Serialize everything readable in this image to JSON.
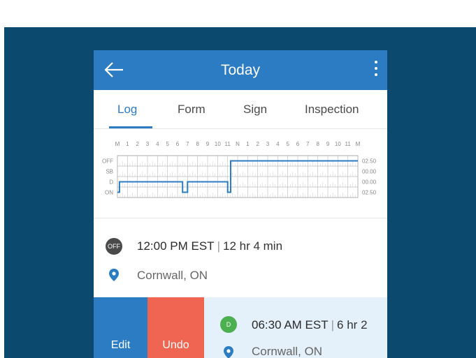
{
  "header": {
    "title": "Today",
    "back_icon": "arrow-left-icon",
    "menu_icon": "more-vertical-icon"
  },
  "tabs": [
    {
      "label": "Log",
      "active": true
    },
    {
      "label": "Form",
      "active": false
    },
    {
      "label": "Sign",
      "active": false
    },
    {
      "label": "Inspection",
      "active": false
    }
  ],
  "graph": {
    "hour_labels": [
      "M",
      "1",
      "2",
      "3",
      "4",
      "5",
      "6",
      "7",
      "8",
      "9",
      "10",
      "11",
      "N",
      "1",
      "2",
      "3",
      "4",
      "5",
      "6",
      "7",
      "8",
      "9",
      "10",
      "11",
      "M"
    ],
    "row_labels": [
      "OFF",
      "SB",
      "D",
      "ON"
    ],
    "totals": [
      "02.50",
      "00.00",
      "00.00",
      "02.50"
    ],
    "line_color": "#2b7cc2"
  },
  "entries": [
    {
      "status": "OFF",
      "status_color": "#4a4a4a",
      "time": "12:00 PM EST",
      "duration": "12 hr 4 min",
      "location": "Cornwall, ON"
    },
    {
      "status": "D",
      "status_color": "#4caf50",
      "time": "06:30 AM EST",
      "duration": "6 hr 2",
      "location": "Cornwall, ON"
    }
  ],
  "actions": {
    "edit": "Edit",
    "undo": "Undo",
    "edit_color": "#2b7cc2",
    "undo_color": "#ef6552"
  }
}
